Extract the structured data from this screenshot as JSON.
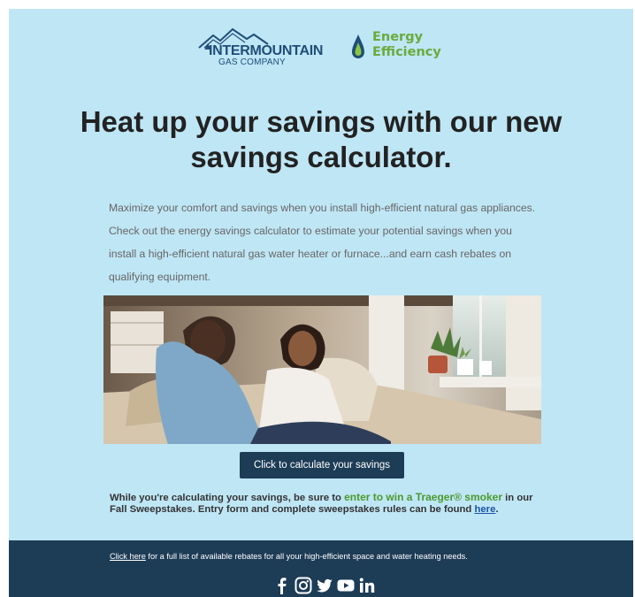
{
  "brand": {
    "company_name": "INTERMOUNTAIN",
    "company_sub": "GAS COMPANY",
    "program_line1": "Energy",
    "program_line2": "Efficiency"
  },
  "headline": "Heat up your savings with our new savings calculator.",
  "intro": "Maximize your comfort and savings when you install high-efficient natural gas appliances. Check out the energy savings calculator to estimate your potential savings when you install a high-efficient natural gas water heater or furnace...and earn cash rebates on qualifying equipment.",
  "cta_label": "Click to calculate your savings",
  "promo": {
    "before": "While you're calculating your savings, be sure to ",
    "highlight": "enter to win a Traeger® smoker",
    "after": " in our Fall Sweepstakes. Entry form and complete sweepstakes rules can be found ",
    "link": "here",
    "end": "."
  },
  "footer": {
    "link": "Click here",
    "text": " for a full list of available rebates for all your high-efficient space and water heating needs."
  },
  "social": [
    "facebook-icon",
    "instagram-icon",
    "twitter-icon",
    "youtube-icon",
    "linkedin-icon"
  ],
  "colors": {
    "background": "#bfe6f5",
    "footer": "#1d3c56",
    "button": "#1d3c56",
    "brand_green": "#6aab3c",
    "brand_blue": "#1f4e79",
    "link": "#1a55a6"
  }
}
